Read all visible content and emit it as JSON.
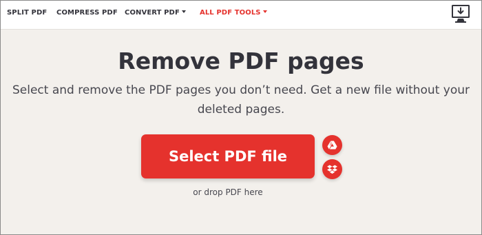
{
  "nav": {
    "items": [
      {
        "label": "SPLIT PDF"
      },
      {
        "label": "COMPRESS PDF"
      },
      {
        "label": "CONVERT PDF"
      },
      {
        "label": "ALL PDF TOOLS"
      }
    ],
    "desktop_icon": "desktop-download-icon"
  },
  "hero": {
    "title": "Remove PDF pages",
    "subtitle": "Select and remove the PDF pages you don’t need. Get a new file without your deleted pages."
  },
  "upload": {
    "button_label": "Select PDF file",
    "drop_hint": "or drop PDF here",
    "cloud_options": [
      {
        "icon": "google-drive-icon"
      },
      {
        "icon": "dropbox-icon"
      }
    ]
  },
  "colors": {
    "accent": "#e5322d",
    "text": "#33333b",
    "background": "#f3f0ec"
  }
}
